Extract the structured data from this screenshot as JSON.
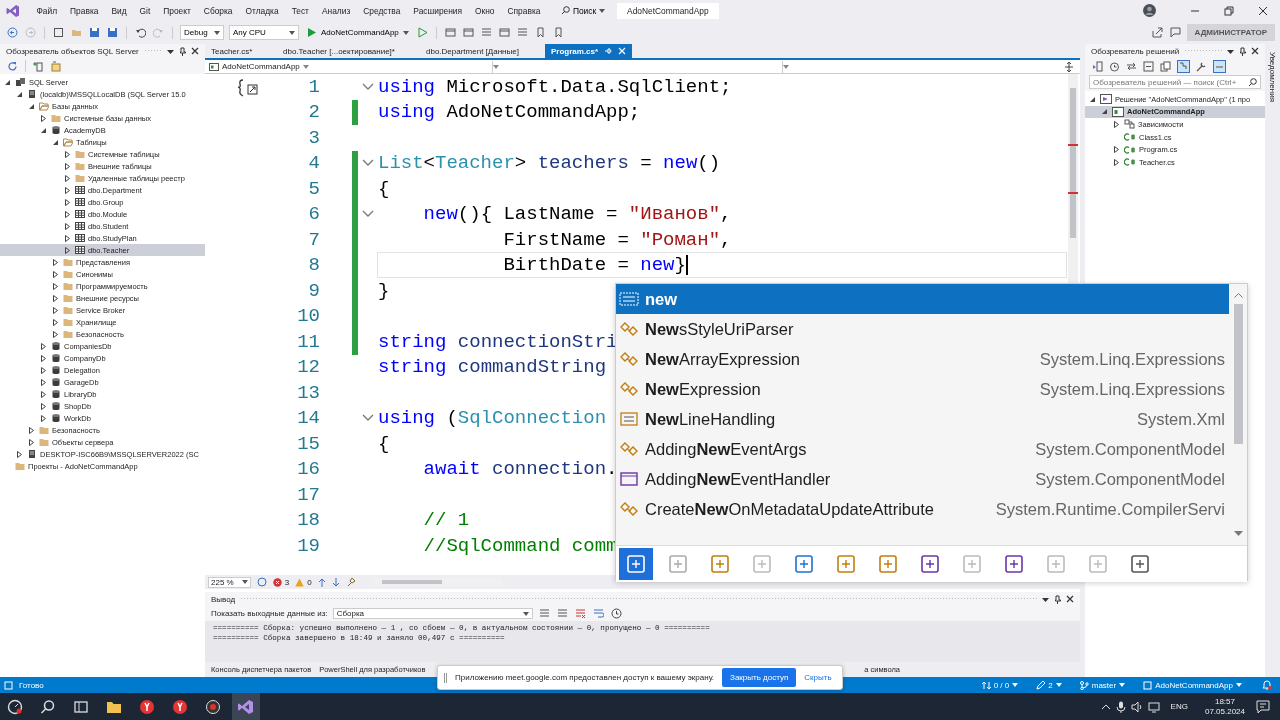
{
  "menu": {
    "items": [
      {
        "label": "Файл"
      },
      {
        "label": "Правка"
      },
      {
        "label": "Вид"
      },
      {
        "label": "Git"
      },
      {
        "label": "Проект"
      },
      {
        "label": "Сборка"
      },
      {
        "label": "Отладка"
      },
      {
        "label": "Тест"
      },
      {
        "label": "Анализ"
      },
      {
        "label": "Средства"
      },
      {
        "label": "Расширения"
      },
      {
        "label": "Окно"
      },
      {
        "label": "Справка"
      }
    ],
    "search": "Поиск",
    "solution_name": "AdoNetCommandApp"
  },
  "toolbar": {
    "configuration": "Debug",
    "platform": "Any CPU",
    "run_target": "AdoNetCommandApp",
    "role": "АДМИНИСТРАТОР"
  },
  "sql_explorer": {
    "title": "Обозреватель объектов SQL Server",
    "tree": [
      {
        "label": "SQL Server",
        "kind": "servers",
        "expanded": true,
        "selected": false,
        "children": [
          {
            "label": "(localdb)\\MSSQLLocalDB (SQL Server 15.0",
            "kind": "server",
            "expanded": true,
            "selected": false,
            "children": [
              {
                "label": "Базы данных",
                "kind": "folder-open",
                "expanded": true,
                "selected": false,
                "children": [
                  {
                    "label": "Системные базы данных",
                    "kind": "folder",
                    "expanded": false,
                    "selected": false
                  },
                  {
                    "label": "AcademyDB",
                    "kind": "database",
                    "expanded": true,
                    "selected": false,
                    "children": [
                      {
                        "label": "Таблицы",
                        "kind": "folder-open",
                        "expanded": true,
                        "selected": false,
                        "children": [
                          {
                            "label": "Системные таблицы",
                            "kind": "folder",
                            "expanded": false,
                            "selected": false
                          },
                          {
                            "label": "Внешние таблицы",
                            "kind": "folder",
                            "expanded": false,
                            "selected": false
                          },
                          {
                            "label": "Удаленные таблицы реестр",
                            "kind": "folder",
                            "expanded": false,
                            "selected": false
                          },
                          {
                            "label": "dbo.Department",
                            "kind": "table",
                            "expanded": false,
                            "selected": false
                          },
                          {
                            "label": "dbo.Group",
                            "kind": "table",
                            "expanded": false,
                            "selected": false
                          },
                          {
                            "label": "dbo.Module",
                            "kind": "table",
                            "expanded": false,
                            "selected": false
                          },
                          {
                            "label": "dbo.Student",
                            "kind": "table",
                            "expanded": false,
                            "selected": false
                          },
                          {
                            "label": "dbo.StudyPlan",
                            "kind": "table",
                            "expanded": false,
                            "selected": false
                          },
                          {
                            "label": "dbo.Teacher",
                            "kind": "table",
                            "expanded": false,
                            "selected": true
                          }
                        ]
                      },
                      {
                        "label": "Представления",
                        "kind": "folder",
                        "expanded": false,
                        "selected": false
                      },
                      {
                        "label": "Синонимы",
                        "kind": "folder",
                        "expanded": false,
                        "selected": false
                      },
                      {
                        "label": "Программируемость",
                        "kind": "folder",
                        "expanded": false,
                        "selected": false
                      },
                      {
                        "label": "Внешние ресурсы",
                        "kind": "folder",
                        "expanded": false,
                        "selected": false
                      },
                      {
                        "label": "Service Broker",
                        "kind": "folder",
                        "expanded": false,
                        "selected": false
                      },
                      {
                        "label": "Хранилище",
                        "kind": "folder",
                        "expanded": false,
                        "selected": false
                      },
                      {
                        "label": "Безопасность",
                        "kind": "folder",
                        "expanded": false,
                        "selected": false
                      }
                    ]
                  },
                  {
                    "label": "CompaniesDb",
                    "kind": "database",
                    "expanded": false,
                    "selected": false
                  },
                  {
                    "label": "CompanyDb",
                    "kind": "database",
                    "expanded": false,
                    "selected": false
                  },
                  {
                    "label": "Delegation",
                    "kind": "database",
                    "expanded": false,
                    "selected": false
                  },
                  {
                    "label": "GarageDb",
                    "kind": "database",
                    "expanded": false,
                    "selected": false
                  },
                  {
                    "label": "LibraryDb",
                    "kind": "database",
                    "expanded": false,
                    "selected": false
                  },
                  {
                    "label": "ShopDb",
                    "kind": "database",
                    "expanded": false,
                    "selected": false
                  },
                  {
                    "label": "WorkDb",
                    "kind": "database",
                    "expanded": false,
                    "selected": false
                  }
                ]
              },
              {
                "label": "Безопасность",
                "kind": "folder",
                "expanded": false,
                "selected": false
              },
              {
                "label": "Объекты сервера",
                "kind": "folder",
                "expanded": false,
                "selected": false
              }
            ]
          },
          {
            "label": "DESKTOP-ISC66B9\\MSSQLSERVER2022 (SC",
            "kind": "server",
            "expanded": false,
            "selected": false
          }
        ]
      },
      {
        "label": "Проекты - AdoNetCommandApp",
        "kind": "folder",
        "selected": false
      }
    ]
  },
  "document_tabs": [
    {
      "label": "Teacher.cs*",
      "selected": false
    },
    {
      "label": "dbo.Teacher [...оектирование]*",
      "selected": false
    },
    {
      "label": "dbo.Department [Данные]",
      "selected": false
    },
    {
      "label": "Program.cs*",
      "selected": true
    }
  ],
  "navigation_bar": {
    "project": "AdoNetCommandApp"
  },
  "editor": {
    "lines": [
      {
        "number": "1",
        "fold": true,
        "changed": false,
        "current": false,
        "tokens": [
          {
            "kind": "kw",
            "text": "using"
          },
          {
            "kind": "p",
            "text": " Microsoft.Data.SqlClient;"
          }
        ]
      },
      {
        "number": "2",
        "fold": false,
        "changed": true,
        "current": false,
        "tokens": [
          {
            "kind": "kw",
            "text": "using"
          },
          {
            "kind": "p",
            "text": " AdoNetCommandApp;"
          }
        ]
      },
      {
        "number": "3",
        "fold": false,
        "changed": false,
        "current": false
      },
      {
        "number": "4",
        "fold": true,
        "changed": true,
        "current": false,
        "tokens": [
          {
            "kind": "type",
            "text": "List"
          },
          {
            "kind": "p",
            "text": "<"
          },
          {
            "kind": "type",
            "text": "Teacher"
          },
          {
            "kind": "p",
            "text": "> "
          },
          {
            "kind": "var",
            "text": "teachers"
          },
          {
            "kind": "p",
            "text": " = "
          },
          {
            "kind": "kw",
            "text": "new"
          },
          {
            "kind": "p",
            "text": "()"
          }
        ]
      },
      {
        "number": "5",
        "fold": false,
        "changed": true,
        "current": false,
        "tokens": [
          {
            "kind": "p",
            "text": "{"
          }
        ]
      },
      {
        "number": "6",
        "fold": true,
        "changed": true,
        "current": false,
        "tokens": [
          {
            "kind": "kw",
            "text": "    new"
          },
          {
            "kind": "p",
            "text": "(){ LastName = "
          },
          {
            "kind": "str",
            "text": "\"Иванов\""
          },
          {
            "kind": "p",
            "text": ","
          }
        ]
      },
      {
        "number": "7",
        "fold": false,
        "changed": true,
        "current": false,
        "tokens": [
          {
            "kind": "p",
            "text": "           FirstName = "
          },
          {
            "kind": "str",
            "text": "\"Роман\""
          },
          {
            "kind": "p",
            "text": ","
          }
        ]
      },
      {
        "number": "8",
        "fold": false,
        "changed": true,
        "current": true,
        "tokens": [
          {
            "kind": "p",
            "text": "           BirthDate = "
          },
          {
            "kind": "kw",
            "text": "new"
          },
          {
            "kind": "p",
            "text": "}"
          }
        ]
      },
      {
        "number": "9",
        "fold": false,
        "changed": true,
        "current": false,
        "tokens": [
          {
            "kind": "p",
            "text": "}"
          }
        ]
      },
      {
        "number": "10",
        "fold": false,
        "changed": true,
        "current": false
      },
      {
        "number": "11",
        "fold": false,
        "changed": true,
        "current": false,
        "tokens": [
          {
            "kind": "kw",
            "text": "string"
          },
          {
            "kind": "var",
            "text": " connectionStri"
          }
        ]
      },
      {
        "number": "12",
        "fold": false,
        "changed": false,
        "current": false,
        "tokens": [
          {
            "kind": "kw",
            "text": "string"
          },
          {
            "kind": "var",
            "text": " commandString"
          }
        ]
      },
      {
        "number": "13",
        "fold": false,
        "changed": false,
        "current": false
      },
      {
        "number": "14",
        "fold": true,
        "changed": false,
        "current": false,
        "tokens": [
          {
            "kind": "kw",
            "text": "using"
          },
          {
            "kind": "p",
            "text": " ("
          },
          {
            "kind": "type",
            "text": "SqlConnection"
          }
        ]
      },
      {
        "number": "15",
        "fold": false,
        "changed": false,
        "current": false,
        "tokens": [
          {
            "kind": "p",
            "text": "{"
          }
        ]
      },
      {
        "number": "16",
        "fold": false,
        "changed": false,
        "current": false,
        "tokens": [
          {
            "kind": "kw",
            "text": "    await"
          },
          {
            "kind": "var",
            "text": " connection"
          },
          {
            "kind": "p",
            "text": "."
          }
        ]
      },
      {
        "number": "17",
        "fold": false,
        "changed": false,
        "current": false
      },
      {
        "number": "18",
        "fold": false,
        "changed": false,
        "current": false,
        "tokens": [
          {
            "kind": "cmt",
            "text": "    // 1"
          }
        ]
      },
      {
        "number": "19",
        "fold": false,
        "changed": false,
        "current": false,
        "tokens": [
          {
            "kind": "cmt",
            "text": "    //SqlCommand comm"
          }
        ]
      }
    ],
    "zoom": "225 %",
    "errors": "3",
    "warnings": "0"
  },
  "completion": {
    "items": [
      {
        "label": "new",
        "kind": "keyword",
        "selected": true
      },
      {
        "label": "**New**sStyleUriParser",
        "kind": "class",
        "selected": false
      },
      {
        "label": "**New**ArrayExpression",
        "namespace": "System.Linq.Expressions",
        "kind": "class",
        "selected": false
      },
      {
        "label": "**New**Expression",
        "namespace": "System.Linq.Expressions",
        "kind": "class",
        "selected": false
      },
      {
        "label": "**New**LineHandling",
        "namespace": "System.Xml",
        "kind": "enum",
        "selected": false
      },
      {
        "label": "Adding**New**EventArgs",
        "namespace": "System.ComponentModel",
        "kind": "class",
        "selected": false
      },
      {
        "label": "Adding**New**EventHandler",
        "namespace": "System.ComponentModel",
        "kind": "delegate",
        "selected": false
      },
      {
        "label": "Create**New**OnMetadataUpdateAttribute",
        "namespace": "System.Runtime.CompilerServi",
        "kind": "class",
        "selected": false
      }
    ],
    "filters": [
      {
        "kind": "locals",
        "selected": true
      },
      {
        "kind": "snippet",
        "selected": false
      },
      {
        "kind": "class",
        "selected": false
      },
      {
        "kind": "constant",
        "selected": false
      },
      {
        "kind": "delegate",
        "selected": false
      },
      {
        "kind": "enum",
        "selected": false
      },
      {
        "kind": "event",
        "selected": false
      },
      {
        "kind": "module",
        "selected": false
      },
      {
        "kind": "field",
        "selected": false
      },
      {
        "kind": "method",
        "selected": false
      },
      {
        "kind": "interface",
        "selected": false
      },
      {
        "kind": "struct",
        "selected": false
      },
      {
        "kind": "keyword",
        "selected": false
      }
    ]
  },
  "output": {
    "title": "Вывод",
    "source_label": "Показать выходные данные из:",
    "source": "Сборка",
    "lines": [
      "========== Сборка: успешно выполнено — 1 , со сбоем — 0, в актуальном состоянии — 0, пропущено — 0 ==========",
      "========== Сборка завершено в 18:49 и заняло 00,497 с =========="
    ]
  },
  "bottom_tabs": [
    {
      "label": "Консоль диспетчера пакетов"
    },
    {
      "label": "PowerShell для разработчиков"
    },
    {
      "label": "а символа"
    }
  ],
  "solution_explorer": {
    "title": "Обозреватель решений",
    "search_placeholder": "Обозреватель решений — поиск (Ctrl+",
    "tree": [
      {
        "label": "Решение \"AdoNetCommandApp\" (1 про",
        "kind": "solution",
        "expanded": true,
        "selected": false,
        "children": [
          {
            "label": "AdoNetCommandApp",
            "kind": "project",
            "expanded": true,
            "selected": true,
            "children": [
              {
                "label": "Зависимости",
                "kind": "deps",
                "expanded": false,
                "selected": false
              },
              {
                "label": "Class1.cs",
                "kind": "csharp",
                "selected": false
              },
              {
                "label": "Program.cs",
                "kind": "csharp",
                "expanded": false,
                "selected": false
              },
              {
                "label": "Teacher.cs",
                "kind": "csharp",
                "expanded": false,
                "selected": false
              }
            ]
          }
        ]
      }
    ]
  },
  "notifications_label": "Уведомления",
  "status_bar": {
    "message": "Готово",
    "changes": "0 / 0",
    "commits": "2",
    "branch": "master",
    "repository": "AdoNetCommandApp"
  },
  "screen_share": {
    "message": "Приложению meet.google.com предоставлен доступ к вашему экрану.",
    "stop_button": "Закрыть доступ",
    "hide_link": "Скрыть"
  },
  "taskbar": {
    "language": "ENG",
    "time": "18:57",
    "date": "07.05.2024"
  }
}
